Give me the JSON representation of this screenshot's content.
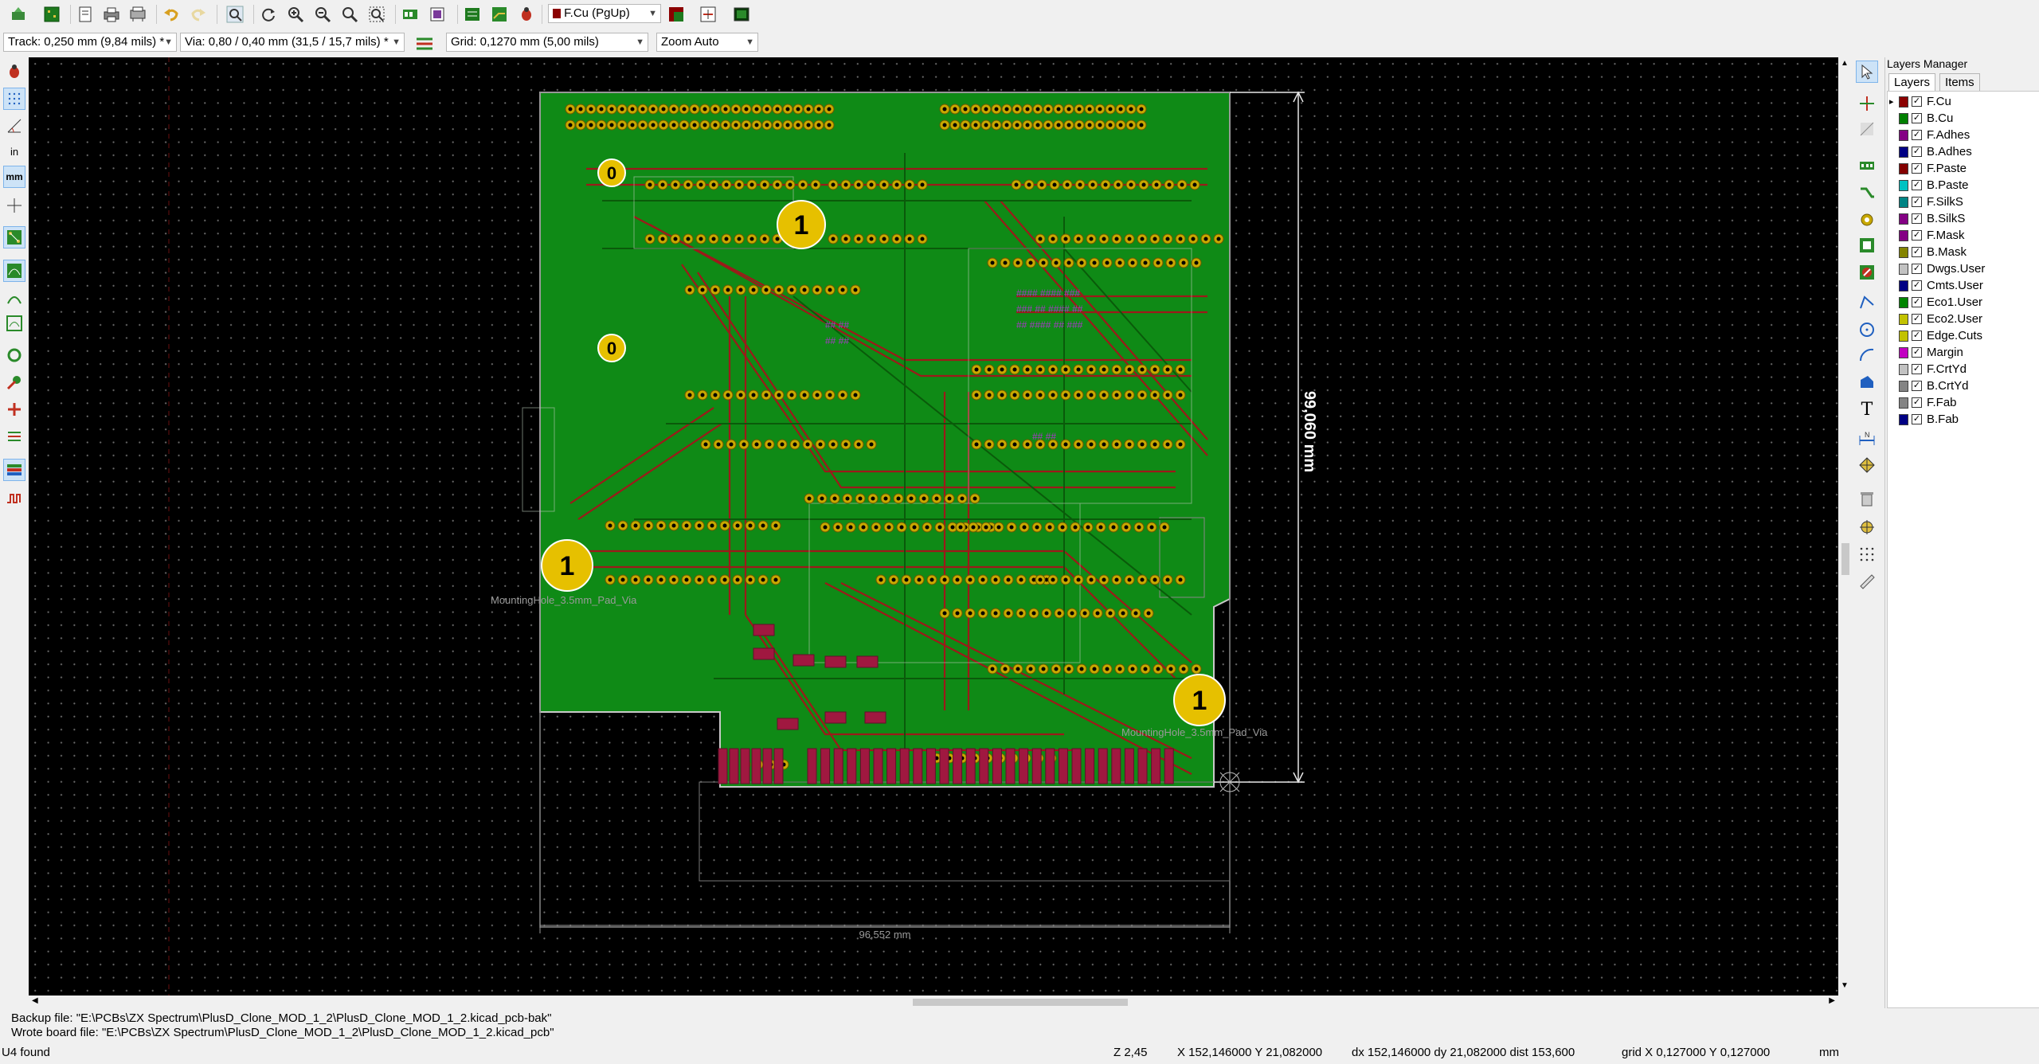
{
  "toolbar": {
    "layer_select": "F.Cu (PgUp)",
    "layer_select_color": "#8b0000",
    "icons": [
      "board-setup-icon",
      "pcb-icon",
      "page-settings-icon",
      "print-icon",
      "plot-icon",
      "undo-icon",
      "redo-icon",
      "find-icon",
      "refresh-icon",
      "zoom-in-icon",
      "zoom-out-icon",
      "zoom-fit-icon",
      "zoom-selection-icon",
      "netlist-icon",
      "footprint-editor-icon",
      "library-browser-icon",
      "autoroute-icon",
      "drc-icon",
      "layer-pair-icon",
      "script-console-icon"
    ]
  },
  "toolbar2": {
    "track": "Track: 0,250 mm (9,84 mils) *",
    "via": "Via: 0,80 / 0,40 mm (31,5 / 15,7 mils) *",
    "grid": "Grid: 0,1270 mm (5,00 mils)",
    "zoom": "Zoom Auto"
  },
  "pcb": {
    "dim_vertical": "99,060 mm",
    "dim_horizontal": "96,552 mm",
    "mounting_hole_label": "MountingHole_3.5mm_Pad_Via",
    "mounting_hole_glyph_0": "0",
    "mounting_hole_glyph_1": "1",
    "colors": {
      "board": "#0f8a16",
      "copper_front": "#9c1a1a",
      "copper_back": "#0a8a0a",
      "pad": "#c8a800",
      "edge": "#c8c8c8",
      "fab": "#7a7a7a"
    }
  },
  "layers_manager": {
    "title": "Layers Manager",
    "tabs": [
      "Layers",
      "Items"
    ],
    "layers": [
      {
        "name": "F.Cu",
        "color": "#8b0000",
        "checked": true
      },
      {
        "name": "B.Cu",
        "color": "#008000",
        "checked": true
      },
      {
        "name": "F.Adhes",
        "color": "#840084",
        "checked": true
      },
      {
        "name": "B.Adhes",
        "color": "#000084",
        "checked": true
      },
      {
        "name": "F.Paste",
        "color": "#840000",
        "checked": true
      },
      {
        "name": "B.Paste",
        "color": "#00c2c2",
        "checked": true
      },
      {
        "name": "F.SilkS",
        "color": "#008484",
        "checked": true
      },
      {
        "name": "B.SilkS",
        "color": "#840084",
        "checked": true
      },
      {
        "name": "F.Mask",
        "color": "#840084",
        "checked": true
      },
      {
        "name": "B.Mask",
        "color": "#848400",
        "checked": true
      },
      {
        "name": "Dwgs.User",
        "color": "#c2c2c2",
        "checked": true
      },
      {
        "name": "Cmts.User",
        "color": "#000084",
        "checked": true
      },
      {
        "name": "Eco1.User",
        "color": "#008400",
        "checked": true
      },
      {
        "name": "Eco2.User",
        "color": "#c2c200",
        "checked": true
      },
      {
        "name": "Edge.Cuts",
        "color": "#c2c200",
        "checked": true
      },
      {
        "name": "Margin",
        "color": "#c200c2",
        "checked": true
      },
      {
        "name": "F.CrtYd",
        "color": "#c2c2c2",
        "checked": true
      },
      {
        "name": "B.CrtYd",
        "color": "#848484",
        "checked": true
      },
      {
        "name": "F.Fab",
        "color": "#848484",
        "checked": true
      },
      {
        "name": "B.Fab",
        "color": "#000084",
        "checked": true
      }
    ]
  },
  "messages": {
    "line1": "Backup file: \"E:\\PCBs\\ZX Spectrum\\PlusD_Clone_MOD_1_2\\PlusD_Clone_MOD_1_2.kicad_pcb-bak\"",
    "line2": "Wrote board file: \"E:\\PCBs\\ZX Spectrum\\PlusD_Clone_MOD_1_2\\PlusD_Clone_MOD_1_2.kicad_pcb\""
  },
  "status": {
    "left": "U4 found",
    "zoom": "Z 2,45",
    "xy": "X 152,146000  Y 21,082000",
    "delta": "dx 152,146000  dy 21,082000  dist 153,600",
    "grid": "grid X 0,127000  Y 0,127000",
    "units": "mm"
  }
}
